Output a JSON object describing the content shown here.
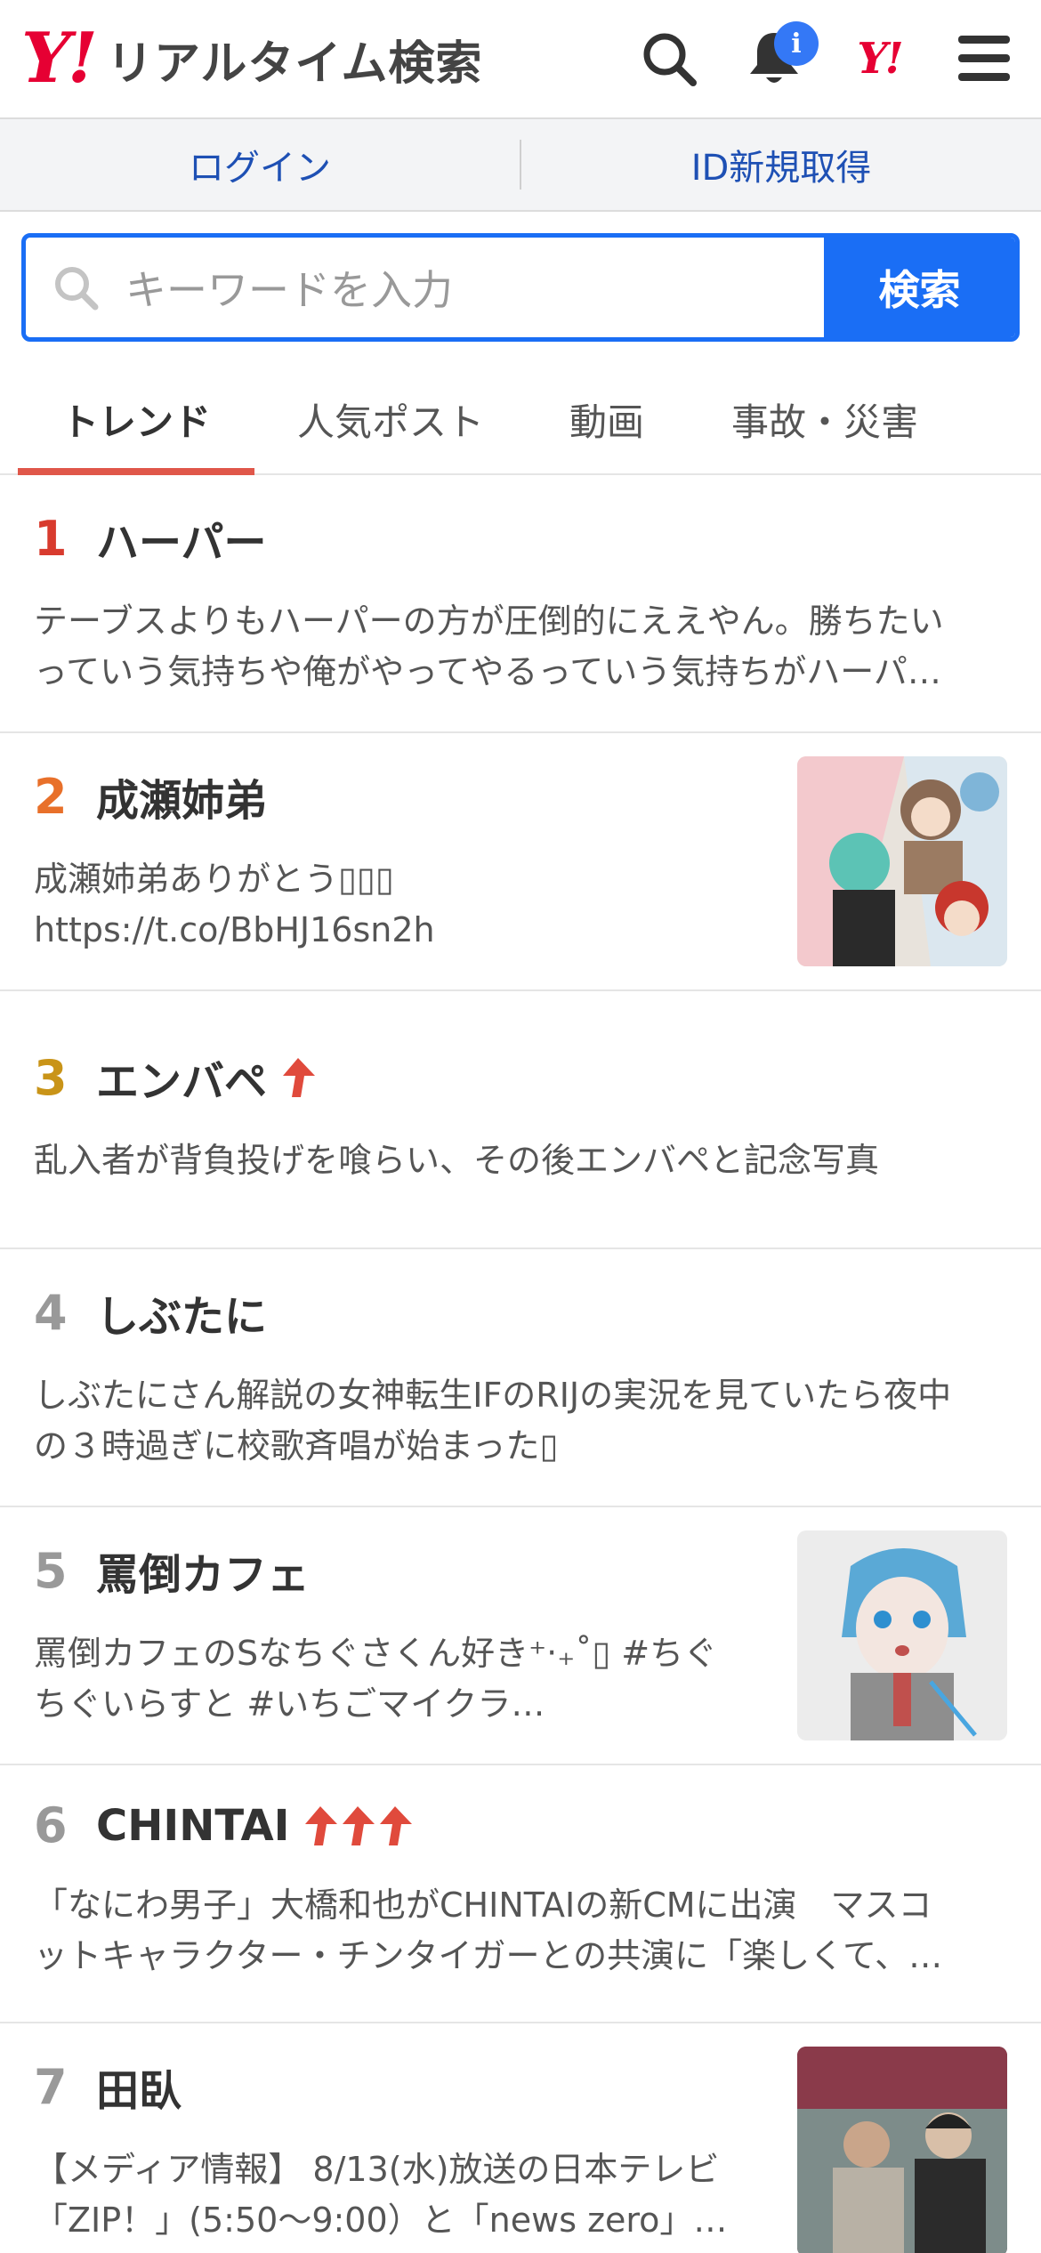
{
  "header": {
    "logo_y": "Y",
    "logo_bang": "!",
    "title": "リアルタイム検索",
    "notification_badge": "i",
    "yahoo_mini": "Y!"
  },
  "auth": {
    "login": "ログイン",
    "register": "ID新規取得"
  },
  "search": {
    "placeholder": "キーワードを入力",
    "button": "検索"
  },
  "tabs": [
    {
      "label": "トレンド",
      "active": true
    },
    {
      "label": "人気ポスト",
      "active": false
    },
    {
      "label": "動画",
      "active": false
    },
    {
      "label": "事故・災害",
      "active": false
    }
  ],
  "trends": [
    {
      "rank": "1",
      "title": "ハーパー",
      "desc1": "テーブスよりもハーパーの方が圧倒的にええやん。勝ちたい",
      "desc2": "っていう気持ちや俺がやってやるっていう気持ちがハーパ…",
      "rank_color": "#d83b2e",
      "arrows": 0,
      "thumb": "none"
    },
    {
      "rank": "2",
      "title": "成瀬姉弟",
      "desc1": "成瀬姉弟ありがとう▯▯▯",
      "desc2": "https://t.co/BbHJ16sn2h",
      "rank_color": "#e8702a",
      "arrows": 0,
      "thumb": "anime-group"
    },
    {
      "rank": "3",
      "title": "エンバペ",
      "desc1": "乱入者が背負投げを喰らい、その後エンバペと記念写真",
      "desc2": "",
      "rank_color": "#c99418",
      "arrows": 1,
      "thumb": "none"
    },
    {
      "rank": "4",
      "title": "しぶたに",
      "desc1": "しぶたにさん解説の女神転生IFのRIJの実況を見ていたら夜中",
      "desc2": "の３時過ぎに校歌斉唱が始まった▯",
      "rank_color": "#999999",
      "arrows": 0,
      "thumb": "none"
    },
    {
      "rank": "5",
      "title": "罵倒カフェ",
      "desc1": "罵倒カフェのSなちぐさくん好き⁺‧₊˚▯ #ちぐ",
      "desc2": "ちぐいらすと #いちごマイクラ…",
      "rank_color": "#999999",
      "arrows": 0,
      "thumb": "anime-boy"
    },
    {
      "rank": "6",
      "title": "CHINTAI",
      "desc1": "「なにわ男子」大橋和也がCHINTAIの新CMに出演　マスコ",
      "desc2": "ットキャラクター・チンタイガーとの共演に「楽しくて、…",
      "rank_color": "#999999",
      "arrows": 3,
      "thumb": "none"
    },
    {
      "rank": "7",
      "title": "田臥",
      "desc1": "【メディア情報】 8/13(水)放送の日本テレビ",
      "desc2": "「ZIP！」(5:50〜9:00）と「news zero」…",
      "rank_color": "#999999",
      "arrows": 0,
      "thumb": "photo-people"
    }
  ]
}
